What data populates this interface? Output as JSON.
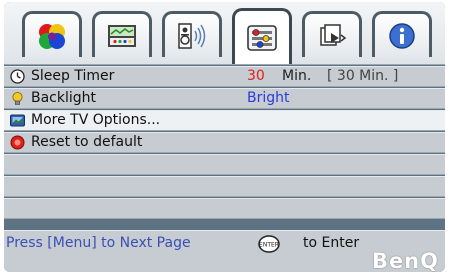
{
  "tabs": [
    {
      "icon": "color-palette-icon"
    },
    {
      "icon": "picture-settings-icon"
    },
    {
      "icon": "audio-speaker-icon"
    },
    {
      "icon": "setup-options-icon",
      "active": true
    },
    {
      "icon": "source-input-icon"
    },
    {
      "icon": "info-icon"
    }
  ],
  "menu": {
    "sleep_timer": {
      "label": "Sleep Timer",
      "value": "30",
      "unit": "Min.",
      "default_display": "[  30   Min. ]"
    },
    "backlight": {
      "label": "Backlight",
      "value": "Bright"
    },
    "more_tv_options": {
      "label": "More TV Options..."
    },
    "reset": {
      "label": "Reset to default"
    }
  },
  "footer": {
    "hint": "Press [Menu] to Next Page",
    "enter_text": "to Enter",
    "enter_icon_label": "ENTER",
    "brand": "BenQ"
  },
  "colors": {
    "frame": "#5d7383",
    "row_bg": "#c6ccd1",
    "selected_row_bg": "#eef1f3",
    "value_red": "#e0201c",
    "value_blue": "#2a3cd8",
    "hint_blue": "#3a4fb5"
  }
}
